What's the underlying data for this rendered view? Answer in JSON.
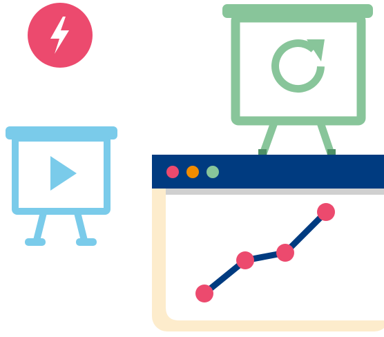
{
  "illustration": {
    "lightning_badge": {
      "icon": "lightning-bolt-icon",
      "color": "#ec4a6e"
    },
    "refresh_board": {
      "icon": "refresh-icon",
      "color": "#88c59a",
      "leg_shadow": "#4e8f66"
    },
    "play_board": {
      "icon": "play-icon",
      "color": "#7acbea"
    },
    "browser_window": {
      "titlebar_color": "#003b80",
      "frame_color": "#fdeccc",
      "divider_color": "#d0d0d0",
      "window_dots": [
        {
          "name": "close-dot",
          "color": "#ec4a6e"
        },
        {
          "name": "minimize-dot",
          "color": "#f28c00"
        },
        {
          "name": "maximize-dot",
          "color": "#88c59a"
        }
      ],
      "line_chart": {
        "line_color": "#003b80",
        "point_color": "#ec4a6e",
        "values": [
          1,
          2.6,
          2.9,
          4.9
        ]
      }
    }
  }
}
